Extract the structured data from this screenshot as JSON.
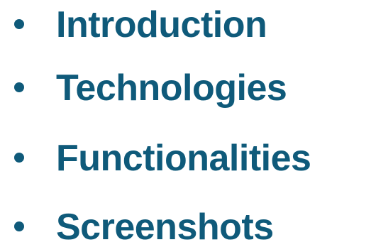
{
  "agenda": {
    "items": [
      {
        "label": "Introduction"
      },
      {
        "label": "Technologies"
      },
      {
        "label": "Functionalities"
      },
      {
        "label": "Screenshots"
      }
    ]
  },
  "colors": {
    "text": "#0f5a7a",
    "background": "#ffffff"
  }
}
